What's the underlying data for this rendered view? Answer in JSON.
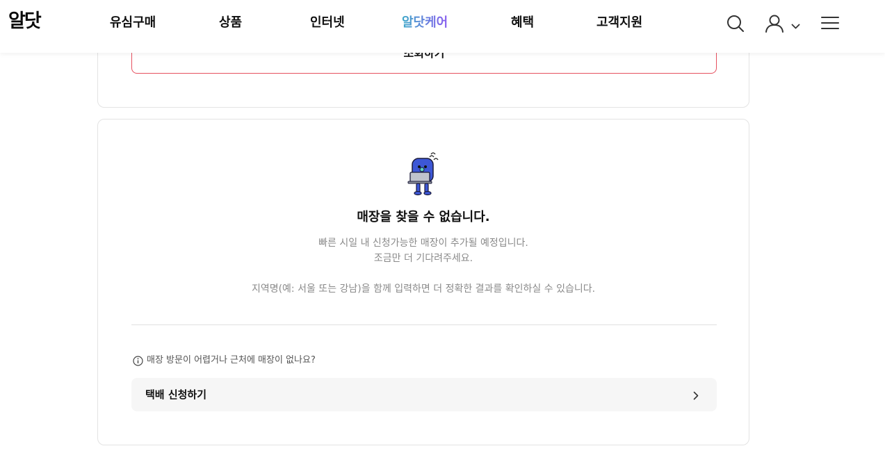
{
  "header": {
    "logo": "알닷",
    "nav": [
      {
        "label": "유심구매"
      },
      {
        "label": "상품"
      },
      {
        "label": "인터넷"
      },
      {
        "label": "알닷케어",
        "active": true
      },
      {
        "label": "혜택"
      },
      {
        "label": "고객지원"
      }
    ],
    "icons": [
      "search-icon",
      "user-icon",
      "chevron-down-icon",
      "menu-icon"
    ]
  },
  "query_card": {
    "button_label": "조회하기"
  },
  "empty_state": {
    "mascot": "mascot-laptop-icon",
    "title": "매장을 찾을 수 없습니다.",
    "desc_line1": "빠른 시일 내 신청가능한 매장이 추가될 예정입니다.",
    "desc_line2": "조금만 더 기다려주세요.",
    "hint": "지역명(예: 서울 또는 강남)을 함께 입력하면 더 정확한 결과를 확인하실 수 있습니다."
  },
  "delivery": {
    "info_text": "매장 방문이 어렵거나 근처에 매장이 없나요?",
    "button_label": "택배 신청하기"
  },
  "colors": {
    "accent_red": "#e6505f",
    "mascot_blue": "#3d57d6",
    "nav_active_gradient": [
      "#3fa9c9",
      "#8a5cf0"
    ]
  }
}
